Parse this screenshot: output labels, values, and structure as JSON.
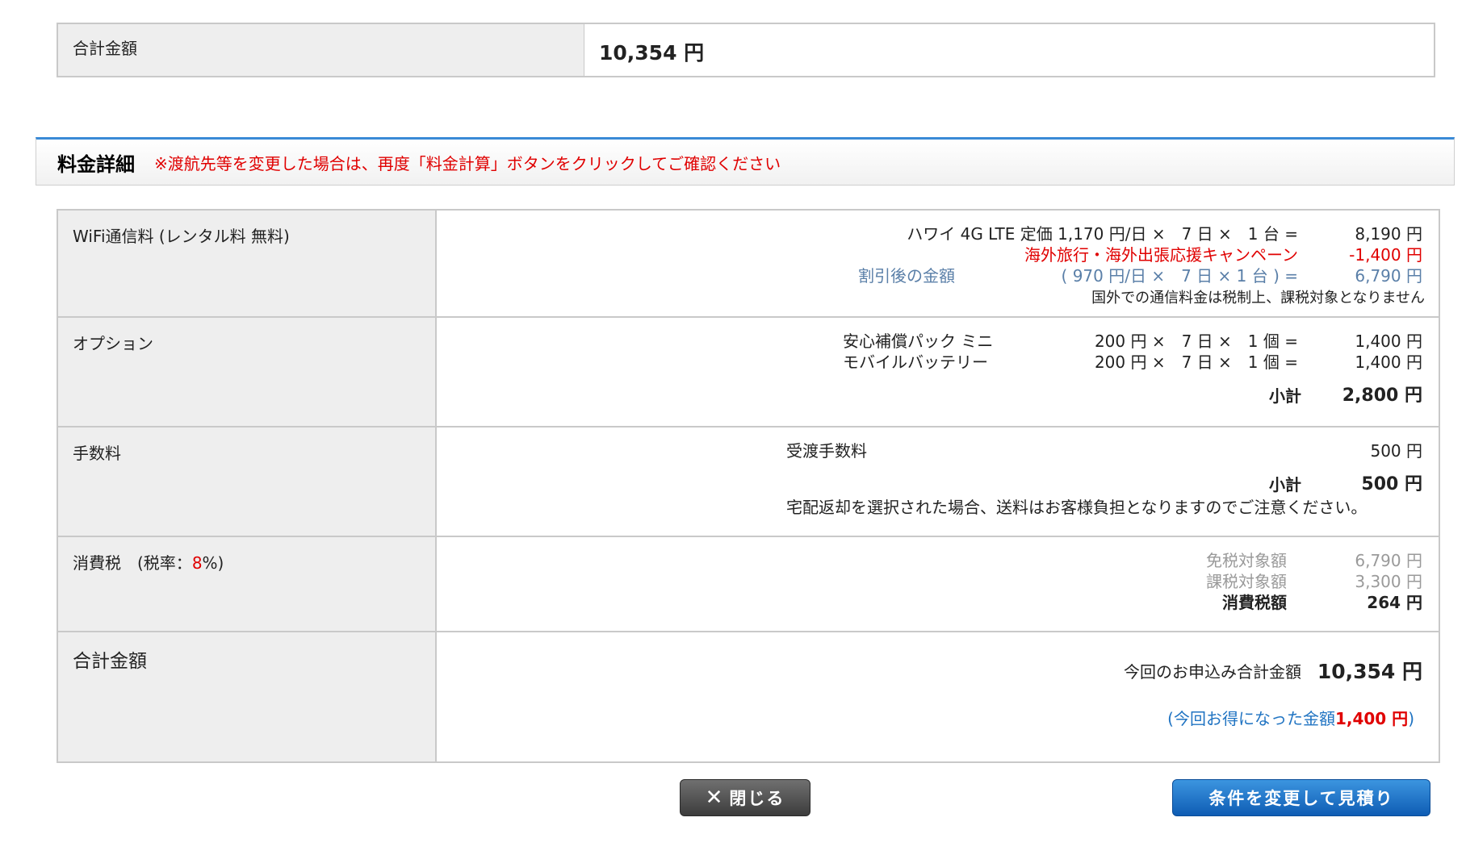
{
  "summary": {
    "label": "合計金額",
    "value": "10,354 円"
  },
  "section": {
    "title": "料金詳細",
    "note": "※渡航先等を変更した場合は、再度「料金計算」ボタンをクリックしてご確認ください"
  },
  "wifi": {
    "label": "WiFi通信料 (レンタル料 無料)",
    "line1_desc": "ハワイ 4G LTE 定価 1,170 円/日 ×　7 日 ×　1 台 =",
    "line1_amt": "8,190 円",
    "campaign_desc": "海外旅行・海外出張応援キャンペーン",
    "campaign_amt": "-1,400 円",
    "discount_label": "割引後の金額",
    "discount_calc": "( 970 円/日 ×　7 日 × 1 台 ) =",
    "discount_amt": "6,790 円",
    "tax_note": "国外での通信料金は税制上、課税対象となりません"
  },
  "option": {
    "label": "オプション",
    "items": [
      {
        "name": "安心補償パック ミニ",
        "calc": "200 円 ×　7 日 ×　1 個 =",
        "amt": "1,400 円"
      },
      {
        "name": "モバイルバッテリー",
        "calc": "200 円 ×　7 日 ×　1 個 =",
        "amt": "1,400 円"
      }
    ],
    "subtotal_label": "小計",
    "subtotal_amt": "2,800 円"
  },
  "fee": {
    "label": "手数料",
    "item_name": "受渡手数料",
    "item_amt": "500 円",
    "subtotal_label": "小計",
    "subtotal_amt": "500 円",
    "note": "宅配返却を選択された場合、送料はお客様負担となりますのでご注意ください。"
  },
  "tax": {
    "label_prefix": "消費税　(税率：",
    "rate": "8",
    "label_suffix": "%)",
    "exempt_label": "免税対象額",
    "exempt_amt": "6,790 円",
    "taxable_label": "課税対象額",
    "taxable_amt": "3,300 円",
    "tax_label": "消費税額",
    "tax_amt": "264 円"
  },
  "total": {
    "label": "合計金額",
    "desc": "今回のお申込み合計金額",
    "amt": "10,354 円",
    "saved_prefix": "(今回お得になった金額",
    "saved_amt": "1,400 円",
    "saved_suffix": ")"
  },
  "buttons": {
    "close": "閉じる",
    "recalc": "条件を変更して見積り"
  },
  "colors": {
    "accent_red": "#e00000",
    "link_blue": "#5a7fa8",
    "button_blue": "#1a6fc4"
  }
}
